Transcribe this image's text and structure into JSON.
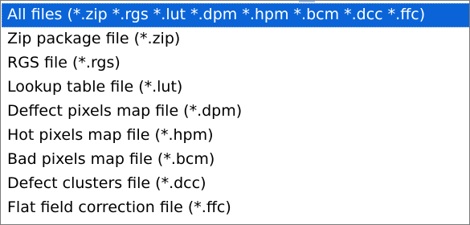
{
  "file_type_list": {
    "selected_index": 0,
    "options": [
      "All files (*.zip *.rgs *.lut *.dpm *.hpm *.bcm *.dcc *.ffc)",
      "Zip package file (*.zip)",
      "RGS file (*.rgs)",
      "Lookup table file (*.lut)",
      "Deffect pixels map file (*.dpm)",
      "Hot pixels map file (*.hpm)",
      "Bad pixels map file (*.bcm)",
      "Defect clusters file (*.dcc)",
      "Flat field correction file (*.ffc)"
    ],
    "colors": {
      "selection_background": "#0a64d8",
      "selection_text": "#ffffff",
      "text": "#000000",
      "border": "#7a7a7a"
    }
  }
}
